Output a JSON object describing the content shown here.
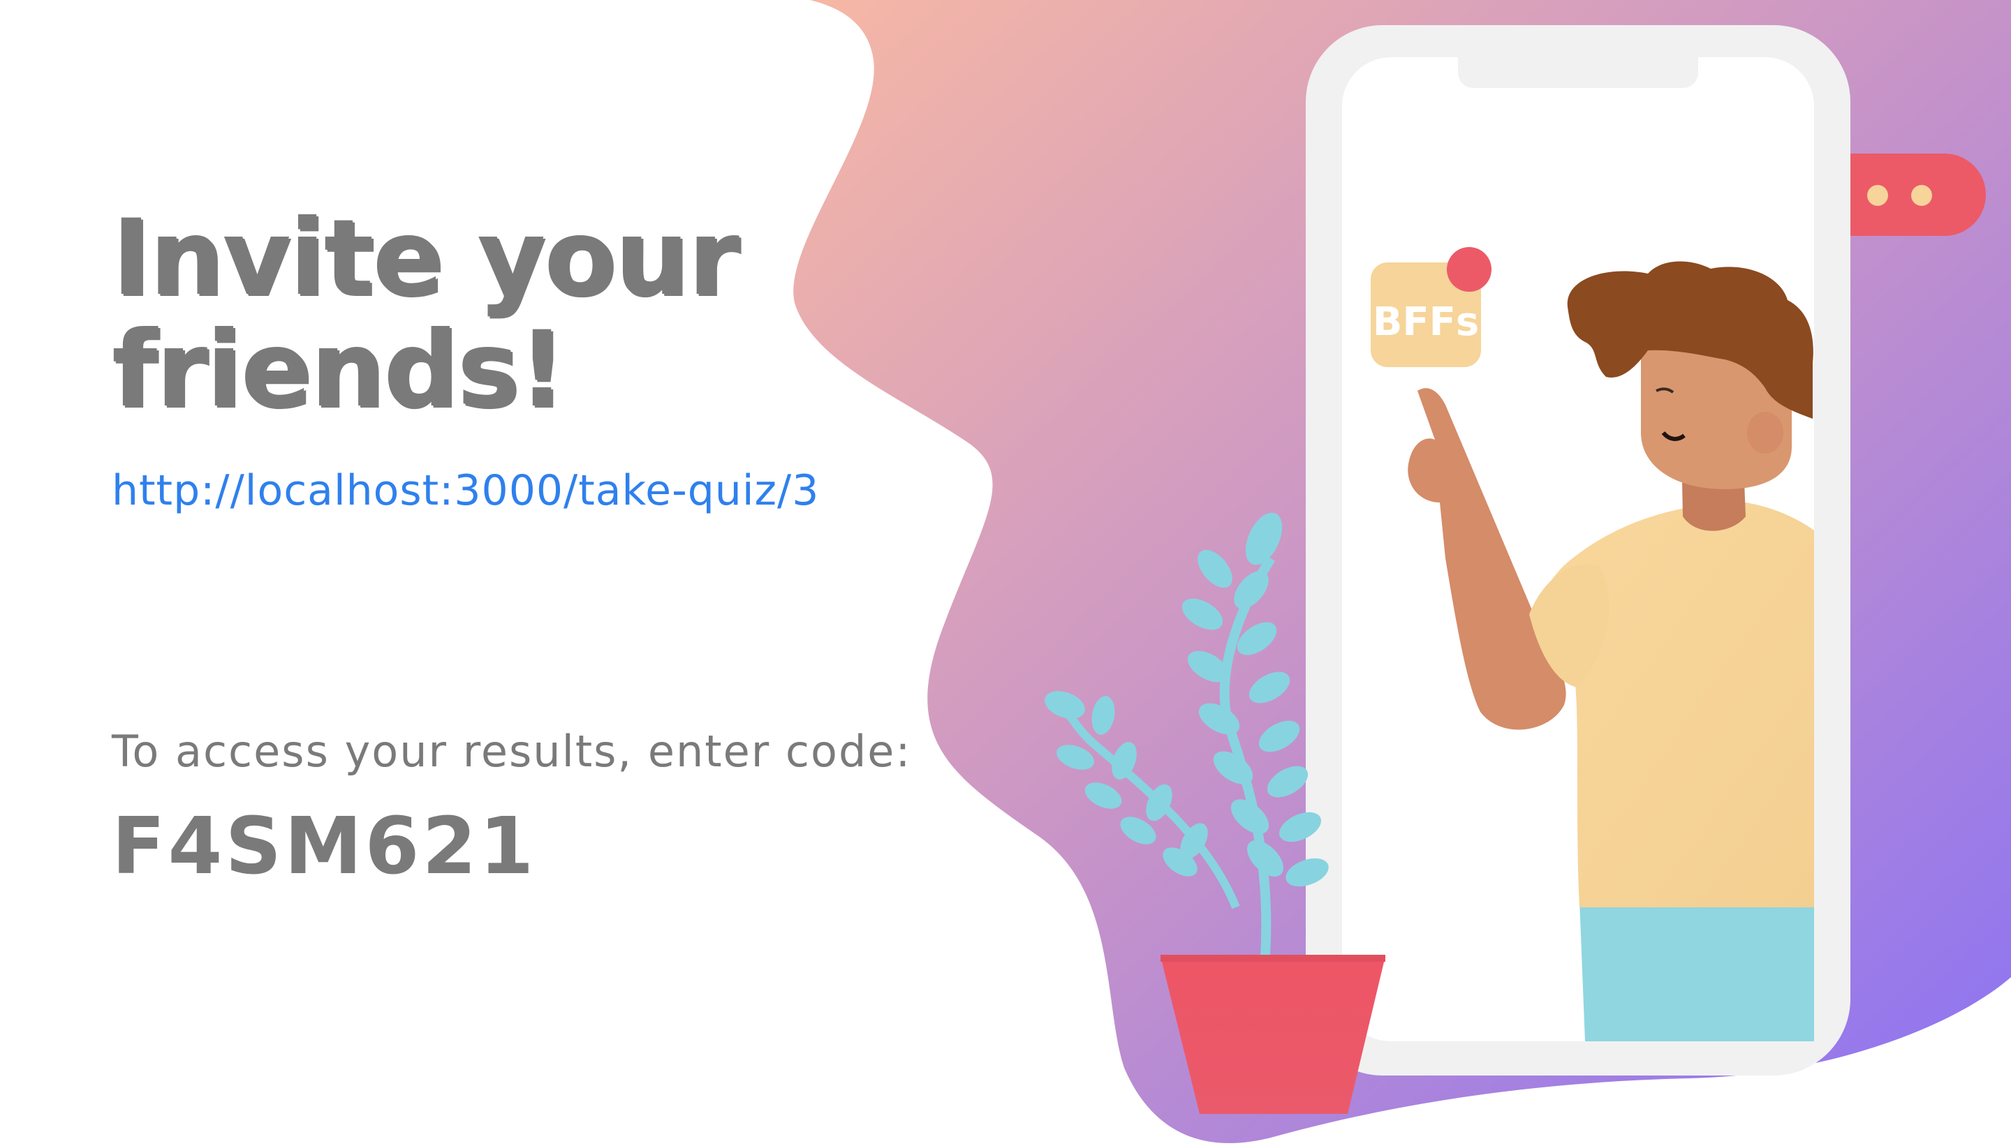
{
  "invite": {
    "title_line1": "Invite your",
    "title_line2": "friends!",
    "quiz_link": "http://localhost:3000/take-quiz/3"
  },
  "results": {
    "prompt": "To access your results, enter code:",
    "code": "F4SM621"
  },
  "illustration": {
    "app_badge": "BFFs",
    "icons": [
      "phone-illustration",
      "chat-bubble-icon",
      "plant-illustration",
      "person-illustration"
    ]
  },
  "colors": {
    "text_gray": "#7a7a7a",
    "link_blue": "#2f80ed",
    "gradient_start": "#f5b4a6",
    "gradient_end": "#8c74f2",
    "bubble_red": "#ec5a68",
    "badge_yellow": "#f6d49a"
  }
}
